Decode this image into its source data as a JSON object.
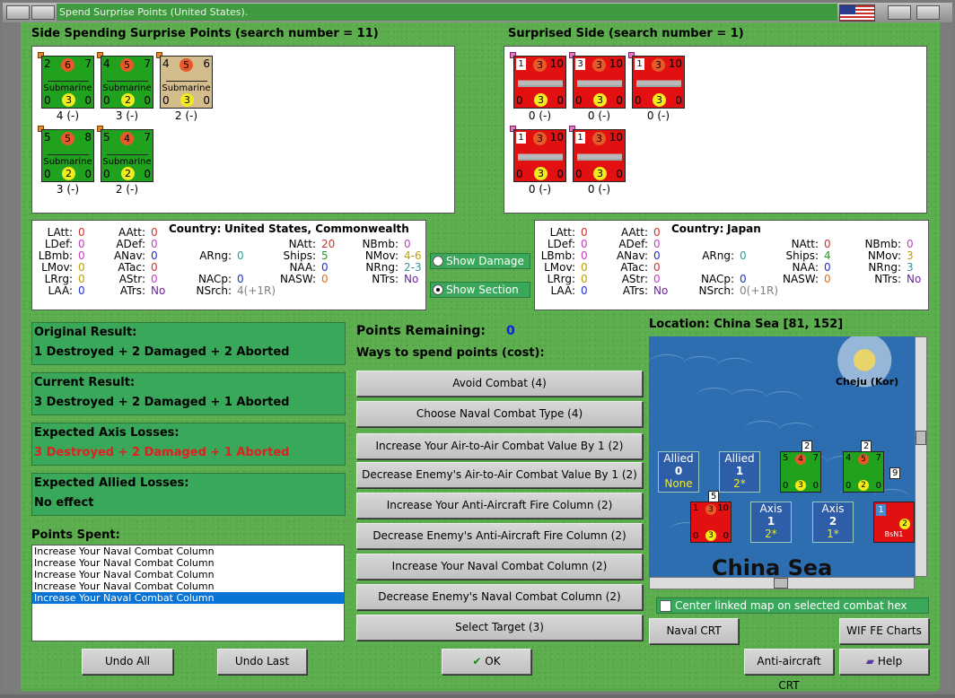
{
  "window": {
    "title": "Spend Surprise Points (United States)."
  },
  "spending": {
    "title": "Side Spending Surprise Points (search number = 11)",
    "counters": [
      {
        "type": "Submarine",
        "top": [
          "2",
          "6",
          "7"
        ],
        "bottom": [
          "0",
          "3",
          "0"
        ],
        "caption": "4 (-)",
        "color": "green"
      },
      {
        "type": "Submarine",
        "top": [
          "4",
          "5",
          "7"
        ],
        "bottom": [
          "0",
          "2",
          "0"
        ],
        "caption": "3 (-)",
        "color": "green"
      },
      {
        "type": "Submarine",
        "top": [
          "4",
          "5",
          "6"
        ],
        "bottom": [
          "0",
          "3",
          "0"
        ],
        "caption": "2 (-)",
        "color": "tan"
      },
      {
        "type": "Submarine",
        "top": [
          "5",
          "5",
          "8"
        ],
        "bottom": [
          "0",
          "2",
          "0"
        ],
        "caption": "3 (-)",
        "color": "green"
      },
      {
        "type": "Submarine",
        "top": [
          "5",
          "4",
          "7"
        ],
        "bottom": [
          "0",
          "2",
          "0"
        ],
        "caption": "2 (-)",
        "color": "green"
      }
    ]
  },
  "surprised": {
    "title": "Surprised Side (search number = 1)",
    "counters": [
      {
        "top": [
          "1",
          "3",
          "10"
        ],
        "bottom": [
          "0",
          "3",
          "0"
        ],
        "caption": "0 (-)"
      },
      {
        "top": [
          "3",
          "3",
          "10"
        ],
        "bottom": [
          "0",
          "3",
          "0"
        ],
        "caption": "0 (-)"
      },
      {
        "top": [
          "1",
          "3",
          "10"
        ],
        "bottom": [
          "0",
          "3",
          "0"
        ],
        "caption": "0 (-)"
      },
      {
        "top": [
          "1",
          "3",
          "10"
        ],
        "bottom": [
          "0",
          "3",
          "0"
        ],
        "caption": "0 (-)"
      },
      {
        "top": [
          "1",
          "3",
          "10"
        ],
        "bottom": [
          "0",
          "3",
          "0"
        ],
        "caption": "0 (-)"
      }
    ]
  },
  "stats_left": {
    "country_label": "Country:",
    "country": "United States, Commonwealth",
    "col1": [
      [
        "LAtt:",
        "0",
        "#d03030"
      ],
      [
        "LDef:",
        "0",
        "#c040c0"
      ],
      [
        "LBmb:",
        "0",
        "#c040c0"
      ],
      [
        "LMov:",
        "0",
        "#c0a000"
      ],
      [
        "LRrg:",
        "0",
        "#c0a000"
      ],
      [
        "LAA:",
        "0",
        "#2030d0"
      ]
    ],
    "col2": [
      [
        "AAtt:",
        "0",
        "#d03030"
      ],
      [
        "ADef:",
        "0",
        "#c040c0"
      ],
      [
        "ANav:",
        "0",
        "#2030d0"
      ],
      [
        "ATac:",
        "0",
        "#d03030"
      ],
      [
        "AStr:",
        "0",
        "#c040c0"
      ],
      [
        "ATrs:",
        "No",
        "#7020a0"
      ]
    ],
    "col3": [
      [
        "ARng:",
        "0",
        "#2a9a9a"
      ],
      [
        "NACp:",
        "0",
        "#2030d0"
      ],
      [
        "NSrch:",
        "4(+1R)",
        "#808080"
      ]
    ],
    "col4": [
      [
        "NAtt:",
        "20",
        "#d03030"
      ],
      [
        "Ships:",
        "5",
        "#20a020"
      ],
      [
        "NAA:",
        "0",
        "#2030d0"
      ],
      [
        "NASW:",
        "0",
        "#e07020"
      ]
    ],
    "col5": [
      [
        "NBmb:",
        "0",
        "#c040c0"
      ],
      [
        "NMov:",
        "4-6",
        "#c0a000"
      ],
      [
        "NRng:",
        "2-3",
        "#2a9a9a"
      ],
      [
        "NTrs:",
        "No",
        "#7020a0"
      ]
    ]
  },
  "stats_right": {
    "country_label": "Country:",
    "country": "Japan",
    "col1": [
      [
        "LAtt:",
        "0",
        "#d03030"
      ],
      [
        "LDef:",
        "0",
        "#c040c0"
      ],
      [
        "LBmb:",
        "0",
        "#c040c0"
      ],
      [
        "LMov:",
        "0",
        "#c0a000"
      ],
      [
        "LRrg:",
        "0",
        "#c0a000"
      ],
      [
        "LAA:",
        "0",
        "#2030d0"
      ]
    ],
    "col2": [
      [
        "AAtt:",
        "0",
        "#d03030"
      ],
      [
        "ADef:",
        "0",
        "#c040c0"
      ],
      [
        "ANav:",
        "0",
        "#2030d0"
      ],
      [
        "ATac:",
        "0",
        "#d03030"
      ],
      [
        "AStr:",
        "0",
        "#c040c0"
      ],
      [
        "ATrs:",
        "No",
        "#7020a0"
      ]
    ],
    "col3": [
      [
        "ARng:",
        "0",
        "#2a9a9a"
      ],
      [
        "NACp:",
        "0",
        "#2030d0"
      ],
      [
        "NSrch:",
        "0(+1R)",
        "#808080"
      ]
    ],
    "col4": [
      [
        "NAtt:",
        "0",
        "#d03030"
      ],
      [
        "Ships:",
        "4",
        "#20a020"
      ],
      [
        "NAA:",
        "0",
        "#2030d0"
      ],
      [
        "NASW:",
        "0",
        "#e07020"
      ]
    ],
    "col5": [
      [
        "NBmb:",
        "0",
        "#c040c0"
      ],
      [
        "NMov:",
        "3",
        "#c0a000"
      ],
      [
        "NRng:",
        "3",
        "#2a9a9a"
      ],
      [
        "NTrs:",
        "No",
        "#7020a0"
      ]
    ]
  },
  "toggles": {
    "show_damage": "Show Damage",
    "show_section": "Show Section"
  },
  "results": {
    "original_label": "Original Result:",
    "original": "1 Destroyed + 2 Damaged + 2 Aborted",
    "current_label": "Current Result:",
    "current": "3 Destroyed + 2 Damaged + 1 Aborted",
    "axis_label": "Expected Axis Losses:",
    "axis": "3 Destroyed + 2 Damaged + 1 Aborted",
    "allied_label": "Expected Allied Losses:",
    "allied": "No effect"
  },
  "points_spent": {
    "label": "Points Spent:",
    "items": [
      "Increase Your Naval Combat Column",
      "Increase Your Naval Combat Column",
      "Increase Your Naval Combat Column",
      "Increase Your Naval Combat Column",
      "Increase Your Naval Combat Column"
    ],
    "selected_index": 4
  },
  "points": {
    "remaining_label": "Points Remaining:",
    "remaining": "0",
    "ways_label": "Ways to spend points (cost):"
  },
  "options": [
    "Avoid Combat (4)",
    "Choose Naval Combat Type (4)",
    "Increase Your Air-to-Air Combat Value By 1 (2)",
    "Decrease Enemy's Air-to-Air Combat Value By 1 (2)",
    "Increase Your Anti-Aircraft Fire Column (2)",
    "Decrease Enemy's Anti-Aircraft Fire Column (2)",
    "Increase Your Naval Combat Column (2)",
    "Decrease Enemy's Naval Combat Column (2)",
    "Select Target (3)"
  ],
  "map": {
    "location": "Location: China Sea [81, 152]",
    "island": "Cheju (Kor)",
    "sea_name": "China Sea",
    "allied_boxes": [
      [
        "Allied",
        "0",
        "None"
      ],
      [
        "Allied",
        "1",
        "2*"
      ]
    ],
    "axis_boxes": [
      [
        "Axis",
        "1",
        "2*"
      ],
      [
        "Axis",
        "2",
        "1*"
      ]
    ],
    "stack_counts": [
      "2",
      "2",
      "5",
      "9"
    ],
    "map_units": [
      [
        "5",
        "4",
        "7",
        "0",
        "3",
        "0"
      ],
      [
        "4",
        "5",
        "7",
        "0",
        "2",
        "0"
      ],
      [
        "1",
        "3",
        "10",
        "0",
        "3",
        "0"
      ]
    ],
    "red_unit_label": "BsN1",
    "red_unit_values": [
      "1",
      "2"
    ],
    "center_check": "Center linked map on selected combat hex"
  },
  "buttons": {
    "undo_all": "Undo All",
    "undo_last": "Undo Last",
    "ok": "OK",
    "naval_crt": "Naval CRT",
    "wif_fe": "WIF FE Charts",
    "aa_crt": "Anti-aircraft CRT",
    "help": "Help"
  }
}
